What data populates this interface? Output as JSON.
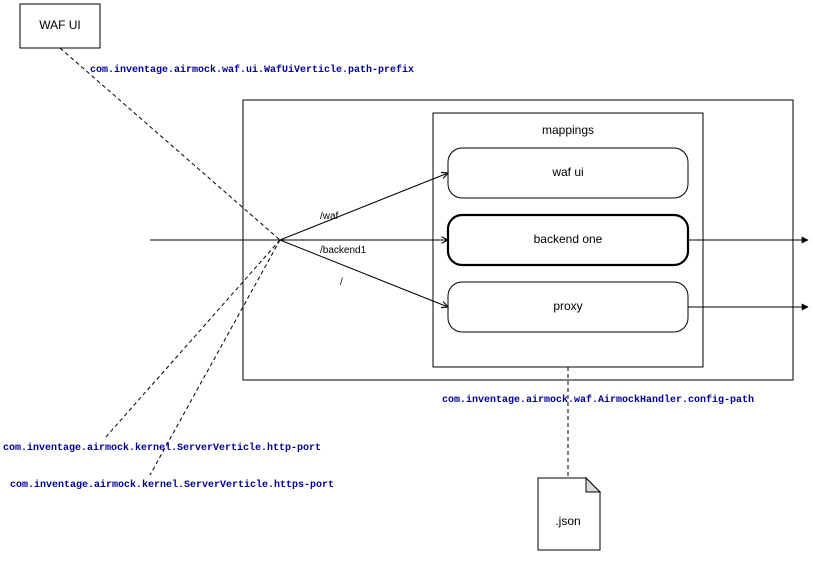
{
  "nodes": {
    "waf_ui_ext": "WAF UI",
    "mappings_title": "mappings",
    "waf_ui": "waf ui",
    "backend_one": "backend one",
    "proxy": "proxy",
    "json_file": ".json"
  },
  "paths": {
    "waf": "/waf",
    "backend1": "/backend1",
    "root": "/"
  },
  "properties": {
    "path_prefix": "com.inventage.airmock.waf.ui.WafUiVerticle.path-prefix",
    "config_path": "com.inventage.airmock.waf.AirmockHandler.config-path",
    "http_port": "com.inventage.airmock.kernel.ServerVerticle.http-port",
    "https_port": "com.inventage.airmock.kernel.ServerVerticle.https-port"
  }
}
